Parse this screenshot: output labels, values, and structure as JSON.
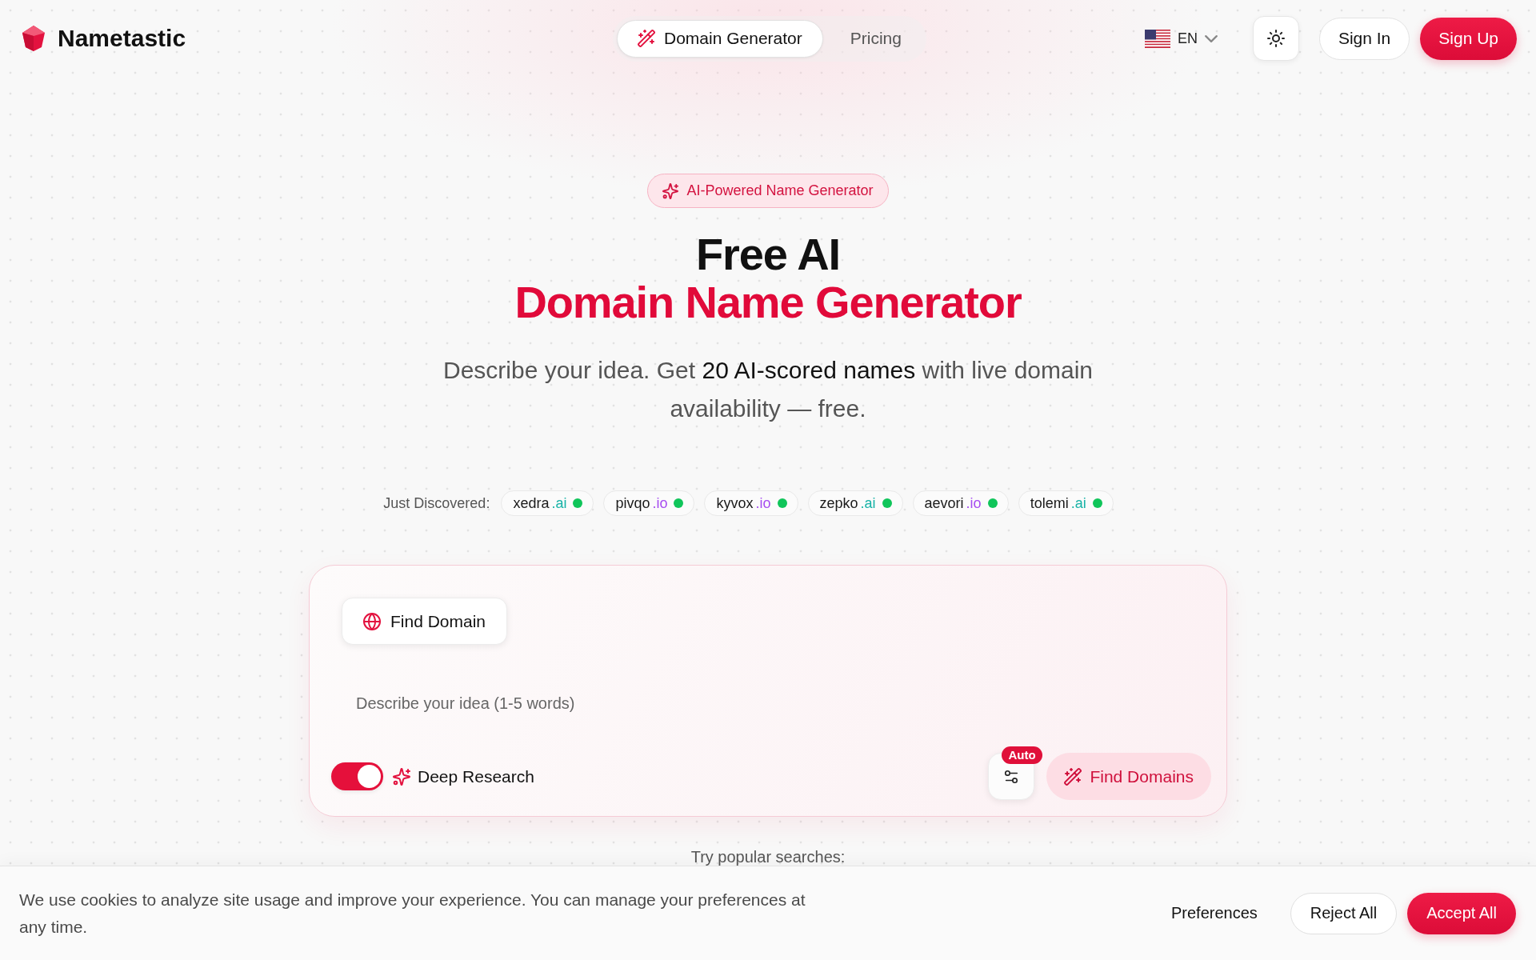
{
  "header": {
    "brand": "Nametastic",
    "nav": [
      {
        "label": "Domain Generator",
        "has_icon": true,
        "selected": true
      },
      {
        "label": "Pricing",
        "has_icon": false,
        "selected": false
      }
    ],
    "language": "EN",
    "auth": [
      {
        "label": "Sign In",
        "kind": "secondary"
      },
      {
        "label": "Sign Up",
        "kind": "primary"
      }
    ]
  },
  "hero": {
    "badge": "AI-Powered Name Generator",
    "title": "Free AI",
    "title_accent": "Domain Name Generator",
    "subtitle": "Describe your idea. Get **20 AI-scored names** with live domain availability — free."
  },
  "discovered": {
    "label": "Just Discovered:",
    "items": [
      {
        "name": "xedra",
        "tld": ".ai",
        "color": "#17b2a6",
        "available": true
      },
      {
        "name": "pivqo",
        "tld": ".io",
        "color": "#a64df0",
        "available": true
      },
      {
        "name": "kyvox",
        "tld": ".io",
        "color": "#a64df0",
        "available": true
      },
      {
        "name": "zepko",
        "tld": ".ai",
        "color": "#17b2a6",
        "available": true
      },
      {
        "name": "aevori",
        "tld": ".io",
        "color": "#a64df0",
        "available": true
      },
      {
        "name": "tolemi",
        "tld": ".ai",
        "color": "#17b2a6",
        "available": true
      }
    ]
  },
  "search_card": {
    "tabs": [
      {
        "label": "Find Domain",
        "selected": true
      }
    ],
    "input": {
      "placeholder": "Describe your idea (1-5 words)"
    },
    "deep_research": {
      "label": "Deep Research",
      "on": true
    },
    "settings_badge": "Auto",
    "submit": "Find Domains"
  },
  "popular": {
    "label": "Try popular searches:"
  },
  "cookie_banner": {
    "text": "We use cookies to analyze site usage and improve your experience. You can manage your preferences at any time.",
    "buttons": [
      {
        "label": "Preferences",
        "kind": "text"
      },
      {
        "label": "Reject All",
        "kind": "outline"
      },
      {
        "label": "Accept All",
        "kind": "primary"
      }
    ]
  }
}
